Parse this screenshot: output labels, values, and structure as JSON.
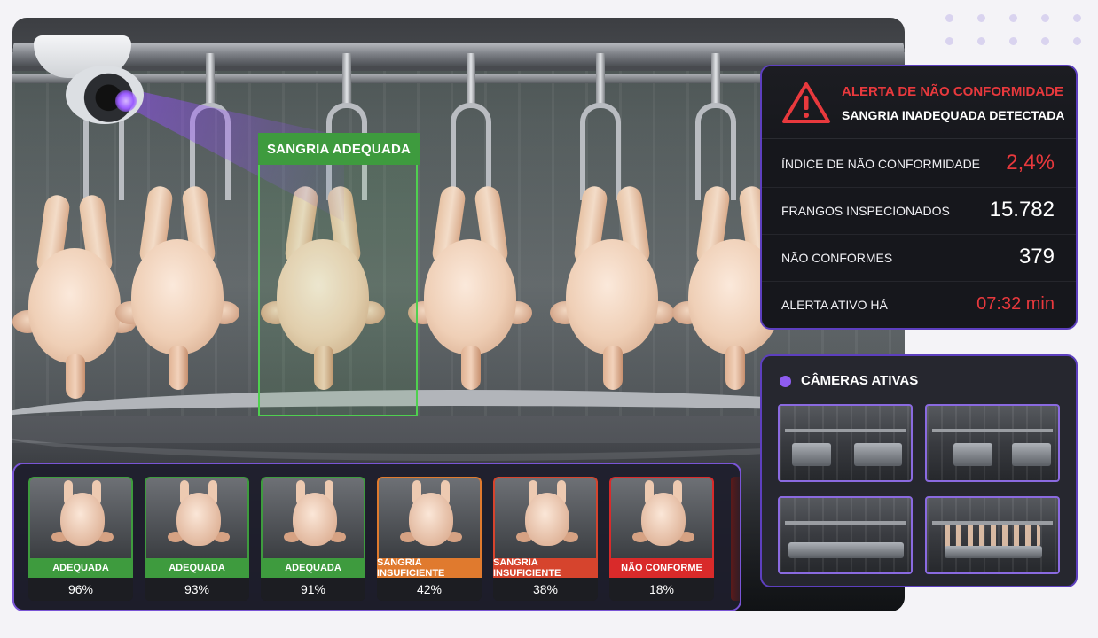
{
  "scene": {
    "detection_label": "SANGRIA ADEQUADA"
  },
  "alert": {
    "title": "ALERTA DE NÃO CONFORMIDADE",
    "subtitle": "SANGRIA INADEQUADA DETECTADA",
    "icon": "warning-triangle-icon",
    "metrics": [
      {
        "label": "ÍNDICE DE NÃO CONFORMIDADE",
        "value": "2,4%",
        "color": "#e8393d"
      },
      {
        "label": "FRANGOS INSPECIONADOS",
        "value": "15.782",
        "color": "#ffffff"
      },
      {
        "label": "NÃO CONFORMES",
        "value": "379",
        "color": "#ffffff"
      },
      {
        "label": "ALERTA ATIVO HÁ",
        "value": "07:32 min",
        "color": "#e8393d"
      }
    ]
  },
  "cameras": {
    "title": "CÂMERAS ATIVAS"
  },
  "thumbnails": [
    {
      "status": "ADEQUADA",
      "confidence": "96%",
      "color": "#3e9b3e"
    },
    {
      "status": "ADEQUADA",
      "confidence": "93%",
      "color": "#3e9b3e"
    },
    {
      "status": "ADEQUADA",
      "confidence": "91%",
      "color": "#3e9b3e"
    },
    {
      "status": "SANGRIA INSUFICIENTE",
      "confidence": "42%",
      "color": "#e07a2e"
    },
    {
      "status": "SANGRIA INSUFICIENTE",
      "confidence": "38%",
      "color": "#d6442d"
    },
    {
      "status": "NÃO CONFORME",
      "confidence": "18%",
      "color": "#d92a2a"
    }
  ],
  "colors": {
    "accent_purple": "#7a55d6",
    "alert_red": "#e8393d",
    "ok_green": "#3e9b3e"
  }
}
